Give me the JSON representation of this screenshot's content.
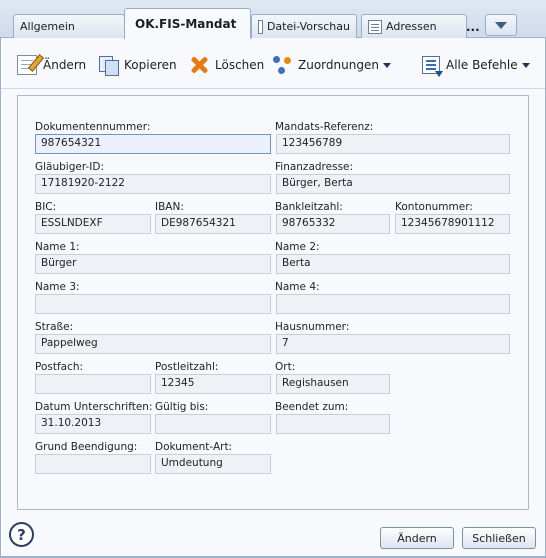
{
  "tabs": {
    "allgemein": "Allgemein",
    "mandat": "OK.FIS-Mandat",
    "vorschau": "Datei-Vorschau",
    "adressen": "Adressen",
    "more": "..."
  },
  "toolbar": {
    "aendern": "Ändern",
    "kopieren": "Kopieren",
    "loeschen": "Löschen",
    "zuordnungen": "Zuordnungen",
    "alle_befehle": "Alle Befehle"
  },
  "form": {
    "dokumentennummer": {
      "label": "Dokumentennummer:",
      "value": "987654321"
    },
    "mandats_referenz": {
      "label": "Mandats-Referenz:",
      "value": "123456789"
    },
    "glaeubiger_id": {
      "label": "Gläubiger-ID:",
      "value": "17181920-2122"
    },
    "finanzadresse": {
      "label": "Finanzadresse:",
      "value": "Bürger, Berta"
    },
    "bic": {
      "label": "BIC:",
      "value": "ESSLNDEXF"
    },
    "iban": {
      "label": "IBAN:",
      "value": "DE987654321"
    },
    "bankleitzahl": {
      "label": "Bankleitzahl:",
      "value": "98765332"
    },
    "kontonummer": {
      "label": "Kontonummer:",
      "value": "12345678901112"
    },
    "name1": {
      "label": "Name 1:",
      "value": "Bürger"
    },
    "name2": {
      "label": "Name 2:",
      "value": "Berta"
    },
    "name3": {
      "label": "Name 3:",
      "value": ""
    },
    "name4": {
      "label": "Name 4:",
      "value": ""
    },
    "strasse": {
      "label": "Straße:",
      "value": "Pappelweg"
    },
    "hausnummer": {
      "label": "Hausnummer:",
      "value": "7"
    },
    "postfach": {
      "label": "Postfach:",
      "value": ""
    },
    "postleitzahl": {
      "label": "Postleitzahl:",
      "value": "12345"
    },
    "ort": {
      "label": "Ort:",
      "value": "Regishausen"
    },
    "datum_unterschriften": {
      "label": "Datum Unterschriften:",
      "value": "31.10.2013"
    },
    "gueltig_bis": {
      "label": "Gültig bis:",
      "value": ""
    },
    "beendet_zum": {
      "label": "Beendet zum:",
      "value": ""
    },
    "grund_beendigung": {
      "label": "Grund Beendigung:",
      "value": ""
    },
    "dokument_art": {
      "label": "Dokument-Art:",
      "value": "Umdeutung"
    }
  },
  "footer": {
    "help": "?",
    "aendern": "Ändern",
    "schliessen": "Schließen"
  }
}
